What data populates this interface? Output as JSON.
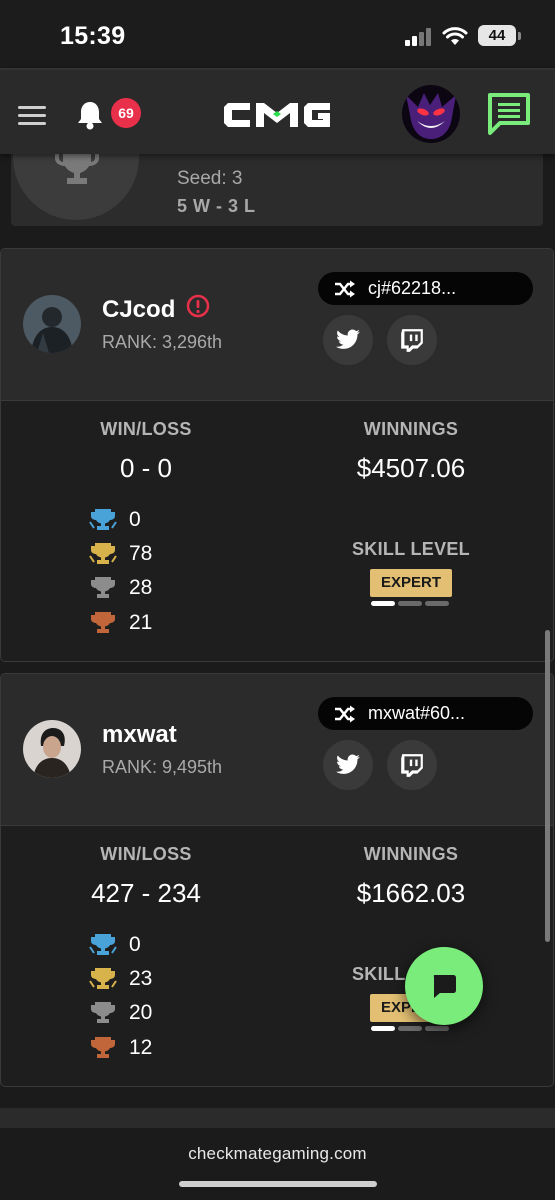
{
  "status_bar": {
    "time": "15:39",
    "battery": "44"
  },
  "nav": {
    "notification_count": "69",
    "logo_text": "CMG"
  },
  "seed_card": {
    "seed": "Seed: 3",
    "record": "5 W - 3 L"
  },
  "labels": {
    "win_loss": "WIN/LOSS",
    "winnings": "WINNINGS",
    "skill_level": "SKILL LEVEL"
  },
  "players": [
    {
      "name": "CJcod",
      "rank": "RANK: 3,296th",
      "gamer_tag": "cj#62218...",
      "win_loss": "0 - 0",
      "winnings": "$4507.06",
      "trophies": {
        "blue": "0",
        "gold": "78",
        "silver": "28",
        "bronze": "21"
      },
      "skill_level": "EXPERT",
      "skill_fraction": 0.333
    },
    {
      "name": "mxwat",
      "rank": "RANK: 9,495th",
      "gamer_tag": "mxwat#60...",
      "win_loss": "427 - 234",
      "winnings": "$1662.03",
      "trophies": {
        "blue": "0",
        "gold": "23",
        "silver": "20",
        "bronze": "12"
      },
      "skill_level": "EXPERT",
      "skill_fraction": 0.333
    }
  ],
  "footer": {
    "url": "checkmategaming.com"
  },
  "colors": {
    "accent_green": "#79ec7c",
    "badge_red": "#e8304a",
    "expert_gold": "#e2bf72",
    "trophy_blue": "#4aa3d8",
    "trophy_gold": "#d8b24a",
    "trophy_silver": "#8c8c8c",
    "trophy_bronze": "#c0663a"
  },
  "icons": [
    "hamburger-icon",
    "bell-icon",
    "chat-icon",
    "alert-icon",
    "shuffle-icon",
    "twitter-icon",
    "twitch-icon",
    "trophy-icon",
    "message-icon"
  ]
}
